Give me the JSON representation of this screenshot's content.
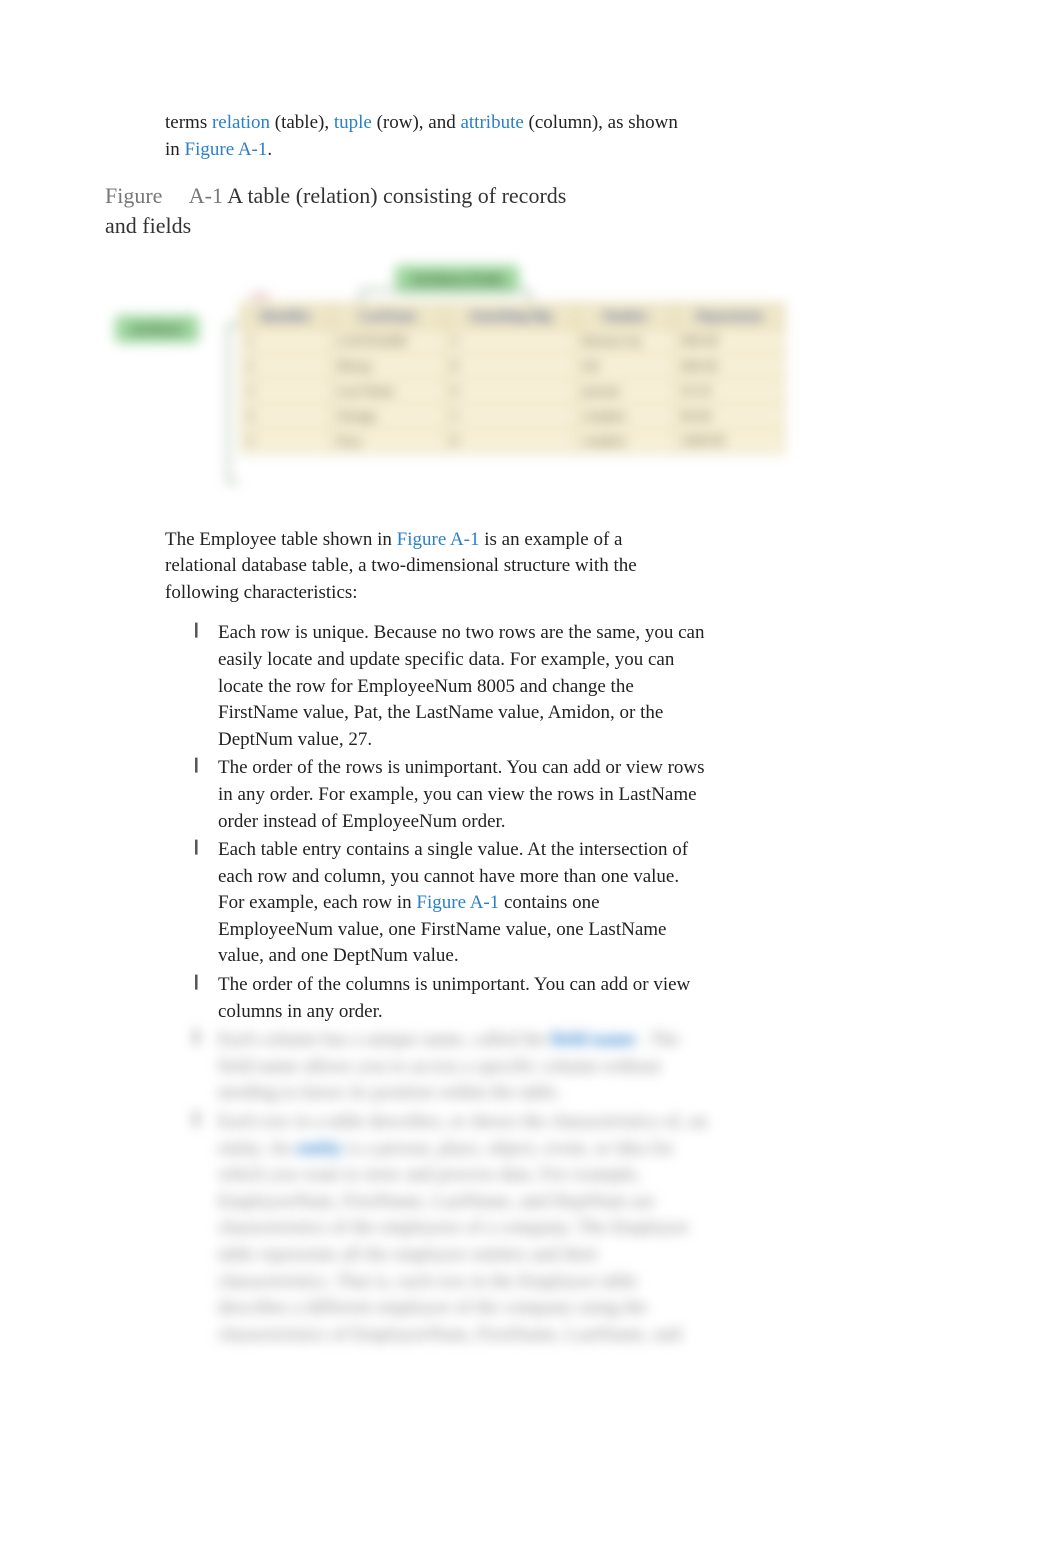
{
  "intro": {
    "pre": "terms ",
    "term1": "relation",
    "mid1": " (table), ",
    "term2": "tuple",
    "mid2": " (row), and ",
    "term3": "attribute",
    "mid3": " (column), as shown in ",
    "figref": "Figure A-1",
    "end": "."
  },
  "figure": {
    "label": "Figure",
    "number": "A-1",
    "title": "A table (relation) consisting of records and fields",
    "callout_top": "Attributes/Fields",
    "callout_left": "attributes",
    "table_name": "Table",
    "headers": [
      "Identifier",
      "LastName",
      "Something-Big",
      "Number",
      "Department"
    ],
    "rows": [
      [
        "1",
        "LASTNAME",
        "3",
        "Bottom-Up",
        "999-99"
      ],
      [
        "2",
        "Mixup",
        "8",
        "left",
        "666-66"
      ],
      [
        "3",
        "Last-Name",
        "9",
        "present",
        "55-55"
      ],
      [
        "4",
        "Strange",
        "5",
        "complex",
        "66-66"
      ],
      [
        "5",
        "Easy",
        "8",
        "complex",
        "1699-99"
      ]
    ]
  },
  "para2": {
    "pre": "The Employee table shown in ",
    "figref": "Figure A-1",
    "post": " is an example of a relational database table, a two-dimensional structure with the following characteristics:"
  },
  "bullets": [
    {
      "text": "Each row is unique. Because no two rows are the same, you can easily locate and update specific data. For example, you can locate the row for EmployeeNum 8005 and change the FirstName value, Pat, the LastName value, Amidon, or the DeptNum value, 27."
    },
    {
      "text": "The order of the rows is unimportant. You can add or view rows in any order. For example, you can view the rows in LastName order instead of EmployeeNum order."
    },
    {
      "pre": "Each table entry contains a single value. At the intersection of each row and column, you cannot have more than one value. For example, each row in ",
      "figref": "Figure A-1",
      "post": " contains one EmployeeNum value, one FirstName value, one LastName value, and one DeptNum value."
    },
    {
      "text": "The order of the columns is unimportant. You can add or view columns in any order."
    }
  ],
  "blurred_bullets": [
    {
      "pre": "Each column has a unique name, called the ",
      "strong": "field name",
      "post": ". The field name allows you to access a specific column without needing to know its position within the table."
    },
    {
      "pre": "Each row in a table describes, or shows the characteristics of, an entity. An ",
      "strong": "entity",
      "post": " is a person, place, object, event, or idea for which you want to store and process data. For example, EmployeeNum, FirstName, LastName, and DeptNum are characteristics of the employees of a company. The Employee table represents all the employee entities and their characteristics. That is, each row in the Employee table describes a different employee of the company using the characteristics of EmployeeNum, FirstName, LastName, and"
    }
  ]
}
